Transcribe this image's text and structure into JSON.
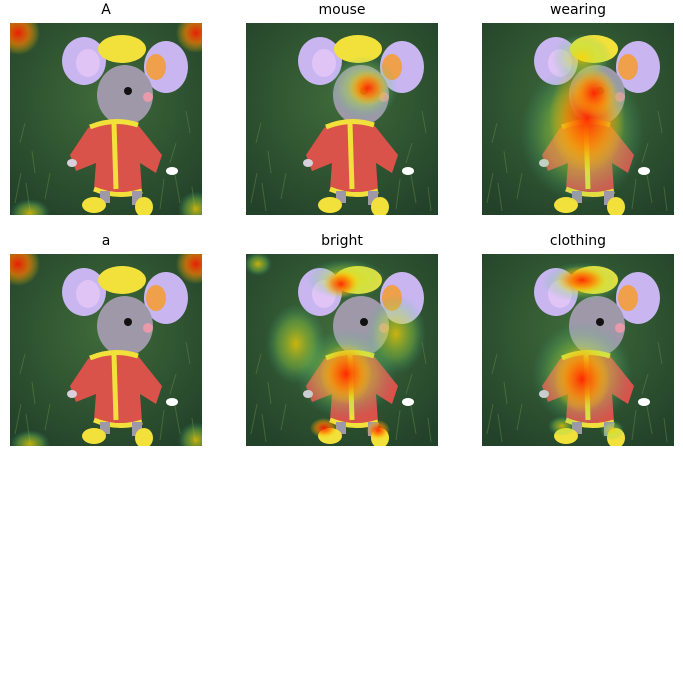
{
  "panels": [
    {
      "title": "A",
      "heat": "corners"
    },
    {
      "title": "mouse",
      "heat": "face"
    },
    {
      "title": "wearing",
      "heat": "body"
    },
    {
      "title": "a",
      "heat": "corners"
    },
    {
      "title": "bright",
      "heat": "scattered"
    },
    {
      "title": "clothing",
      "heat": "clothing"
    }
  ],
  "colors": {
    "grass_dark": "#23422a",
    "grass_light": "#3f6b3a",
    "coat": "#d9534a",
    "trim": "#f2e13a",
    "ear": "#c9b6f0",
    "ear_inner": "#f0a04a",
    "fur": "#9e98a8",
    "heat_hot": "#ff1a00",
    "heat_warm": "#ffd000"
  }
}
